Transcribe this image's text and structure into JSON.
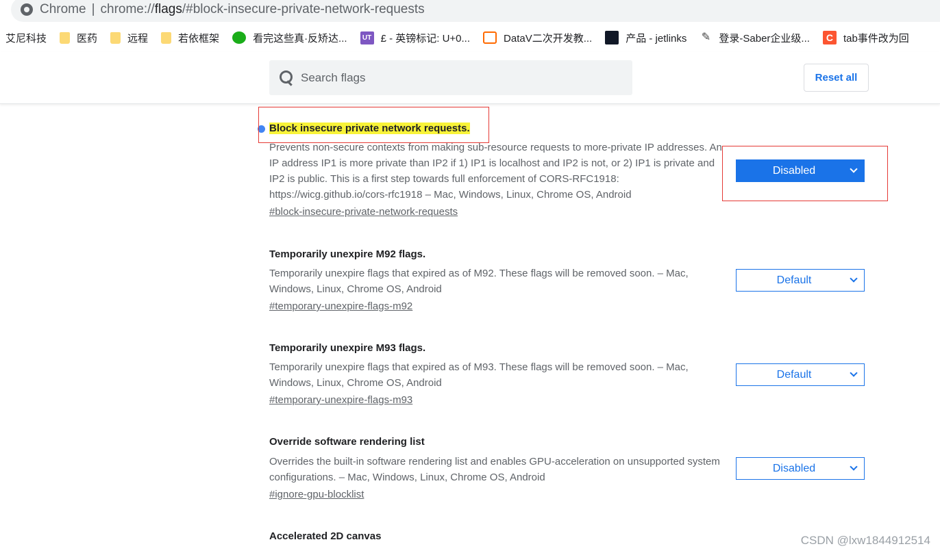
{
  "browser": {
    "site_label": "Chrome",
    "separator": "|",
    "url_a": "chrome://",
    "url_b": "flags",
    "url_c": "/#block-insecure-private-network-requests"
  },
  "bookmarks": [
    {
      "label": "艾尼科技",
      "icon": "none"
    },
    {
      "label": "医药",
      "icon": "folder-icon"
    },
    {
      "label": "远程",
      "icon": "folder-icon"
    },
    {
      "label": "若依框架",
      "icon": "folder-icon"
    },
    {
      "label": "看完这些真·反矫达...",
      "icon": "wechat-icon"
    },
    {
      "label": "£ - 英镑标记: U+0...",
      "icon": "ut-icon"
    },
    {
      "label": "DataV二次开发教...",
      "icon": "datav-icon"
    },
    {
      "label": "产品 - jetlinks",
      "icon": "jetlinks-icon"
    },
    {
      "label": "登录-Saber企业级...",
      "icon": "pen-icon"
    },
    {
      "label": "tab事件改为回",
      "icon": "csdn-icon"
    }
  ],
  "header": {
    "search_placeholder": "Search flags",
    "reset_label": "Reset all"
  },
  "experiments": [
    {
      "title": "Block insecure private network requests.",
      "description": "Prevents non-secure contexts from making sub-resource requests to more-private IP addresses. An IP address IP1 is more private than IP2 if 1) IP1 is localhost and IP2 is not, or 2) IP1 is private and IP2 is public. This is a first step towards full enforcement of CORS-RFC1918: https://wicg.github.io/cors-rfc1918 – Mac, Windows, Linux, Chrome OS, Android",
      "link": "#block-insecure-private-network-requests",
      "value": "Disabled"
    },
    {
      "title": "Temporarily unexpire M92 flags.",
      "description": "Temporarily unexpire flags that expired as of M92. These flags will be removed soon. – Mac, Windows, Linux, Chrome OS, Android",
      "link": "#temporary-unexpire-flags-m92",
      "value": "Default"
    },
    {
      "title": "Temporarily unexpire M93 flags.",
      "description": "Temporarily unexpire flags that expired as of M93. These flags will be removed soon. – Mac, Windows, Linux, Chrome OS, Android",
      "link": "#temporary-unexpire-flags-m93",
      "value": "Default"
    },
    {
      "title": "Override software rendering list",
      "description": "Overrides the built-in software rendering list and enables GPU-acceleration on unsupported system configurations. – Mac, Windows, Linux, Chrome OS, Android",
      "link": "#ignore-gpu-blocklist",
      "value": "Disabled"
    },
    {
      "title": "Accelerated 2D canvas"
    }
  ],
  "watermark": "CSDN @lxw1844912514",
  "colors": {
    "accent": "#1a73e8",
    "highlight": "#f8f339",
    "annotation": "#e53935"
  }
}
